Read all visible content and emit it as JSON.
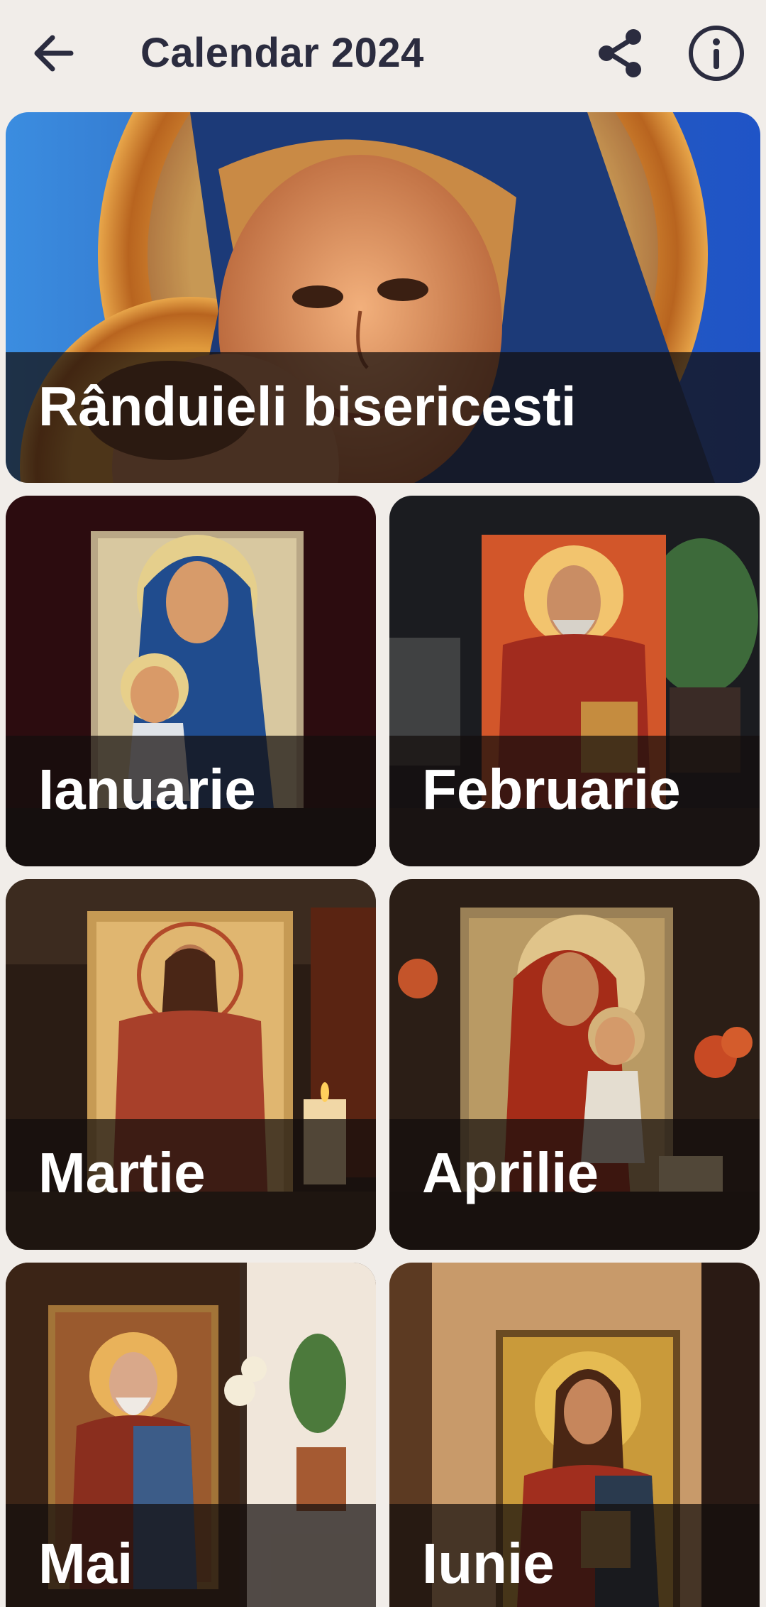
{
  "header": {
    "title": "Calendar 2024",
    "back_icon": "arrow-left-icon",
    "share_icon": "share-icon",
    "info_icon": "info-icon",
    "icon_color": "#2b2c3f"
  },
  "hero": {
    "label": "Rânduieli bisericesti"
  },
  "months": [
    {
      "label": "Ianuarie"
    },
    {
      "label": "Februarie"
    },
    {
      "label": "Martie"
    },
    {
      "label": "Aprilie"
    },
    {
      "label": "Mai"
    },
    {
      "label": "Iunie"
    }
  ],
  "colors": {
    "background": "#f1ede9",
    "title": "#2b2c3f",
    "label_text": "#ffffff",
    "label_band": "#140e0c"
  }
}
